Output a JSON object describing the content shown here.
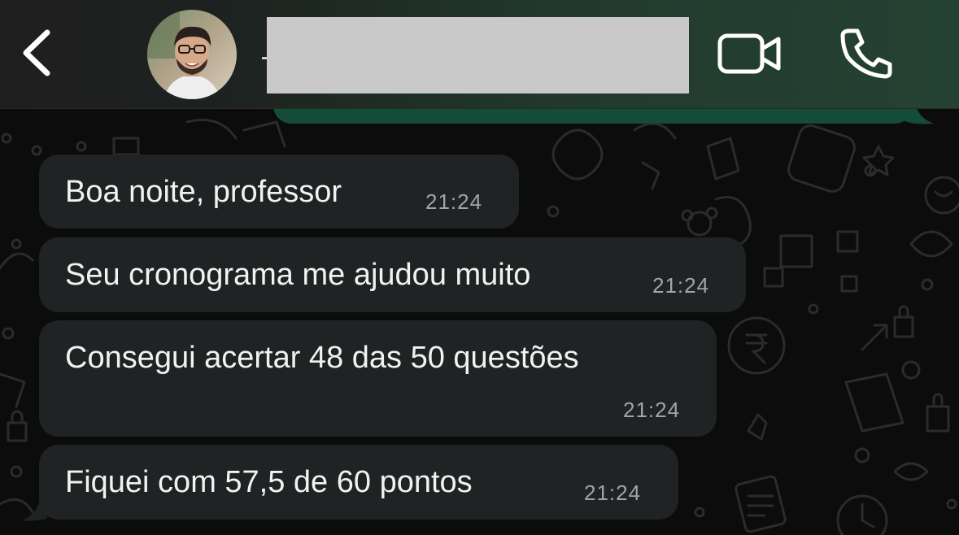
{
  "header": {
    "contact_name": "",
    "icons": {
      "back": "chevron-left-icon",
      "video": "video-camera-icon",
      "call": "phone-icon"
    }
  },
  "messages": [
    {
      "text": "Boa noite, professor",
      "time": "21:24",
      "direction": "incoming"
    },
    {
      "text": "Seu cronograma me ajudou muito",
      "time": "21:24",
      "direction": "incoming"
    },
    {
      "text": "Consegui acertar 48 das 50 questões",
      "time": "21:24",
      "direction": "incoming"
    },
    {
      "text": "Fiquei com 57,5 de 60 pontos",
      "time": "21:24",
      "direction": "incoming"
    }
  ],
  "colors": {
    "incoming_bubble": "#1f2324",
    "outgoing_bubble": "#144d37",
    "timestamp": "#a2a5a6",
    "header_accent": "#244233"
  }
}
